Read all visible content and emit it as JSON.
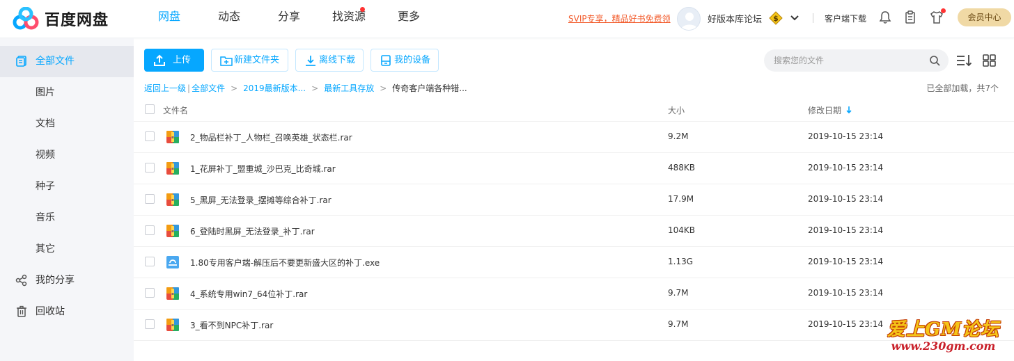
{
  "app": {
    "logo_text": "百度网盘"
  },
  "nav": {
    "items": [
      {
        "label": "网盘",
        "active": true
      },
      {
        "label": "动态",
        "active": false
      },
      {
        "label": "分享",
        "active": false
      },
      {
        "label": "找资源",
        "active": false,
        "dot": true
      },
      {
        "label": "更多",
        "active": false
      }
    ]
  },
  "header": {
    "svip_link": "SVIP专享，精品好书免费领",
    "username": "好版本库论坛",
    "client_download": "客户端下载",
    "member_center": "会员中心"
  },
  "sidebar": {
    "items": [
      {
        "label": "全部文件",
        "icon": "all-files-icon",
        "active": true
      },
      {
        "label": "图片"
      },
      {
        "label": "文档"
      },
      {
        "label": "视频"
      },
      {
        "label": "种子"
      },
      {
        "label": "音乐"
      },
      {
        "label": "其它"
      },
      {
        "label": "我的分享",
        "icon": "share-icon"
      },
      {
        "label": "回收站",
        "icon": "trash-icon"
      }
    ]
  },
  "toolbar": {
    "upload": "上传",
    "new_folder": "新建文件夹",
    "offline_download": "离线下载",
    "my_devices": "我的设备",
    "search_placeholder": "搜索您的文件"
  },
  "breadcrumb": {
    "back": "返回上一级",
    "items": [
      "全部文件",
      "2019最新版本...",
      "最新工具存放"
    ],
    "current": "传奇客户端各种错...",
    "loaded_text": "已全部加载，共7个"
  },
  "table": {
    "headers": {
      "name": "文件名",
      "size": "大小",
      "date": "修改日期"
    },
    "rows": [
      {
        "name": "2_物品栏补丁_人物栏_召唤英雄_状态栏.rar",
        "size": "9.2M",
        "date": "2019-10-15 23:14",
        "type": "rar"
      },
      {
        "name": "1_花屏补丁_盟重城_沙巴克_比奇城.rar",
        "size": "488KB",
        "date": "2019-10-15 23:14",
        "type": "rar"
      },
      {
        "name": "5_黑屏_无法登录_摆摊等综合补丁.rar",
        "size": "17.9M",
        "date": "2019-10-15 23:14",
        "type": "rar"
      },
      {
        "name": "6_登陆时黑屏_无法登录_补丁.rar",
        "size": "104KB",
        "date": "2019-10-15 23:14",
        "type": "rar"
      },
      {
        "name": "1.80专用客户端-解压后不要更新盛大区的补丁.exe",
        "size": "1.13G",
        "date": "2019-10-15 23:14",
        "type": "exe"
      },
      {
        "name": "4_系统专用win7_64位补丁.rar",
        "size": "9.7M",
        "date": "2019-10-15 23:14",
        "type": "rar"
      },
      {
        "name": "3_看不到NPC补丁.rar",
        "size": "9.7M",
        "date": "2019-10-15 23:14",
        "type": "rar"
      }
    ]
  },
  "watermark": {
    "title": "爱上GM论坛",
    "url": "www.230gm.com"
  },
  "colors": {
    "accent": "#06a7ff",
    "member": "#f0d9a5",
    "svip": "#f25a2a"
  }
}
